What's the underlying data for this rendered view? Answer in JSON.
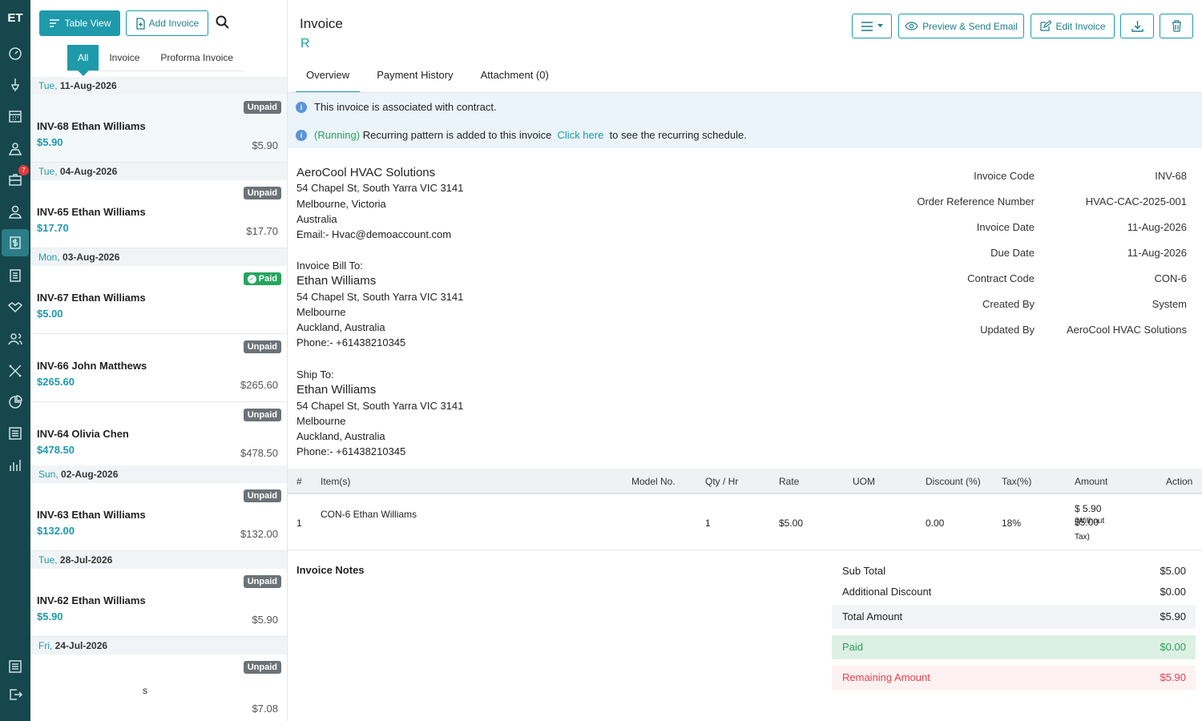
{
  "app": {
    "logo": "ET",
    "notification_count": "7"
  },
  "nav_icons": [
    "dashboard-icon",
    "pin-icon",
    "calendar-icon",
    "map-user-icon",
    "briefcase-icon",
    "user-icon",
    "invoice-dollar-icon",
    "list-icon",
    "handshake-icon",
    "users-icon",
    "tools-icon",
    "chart-pie-icon",
    "report-icon",
    "bar-chart-icon",
    "settings-icon",
    "logout-icon"
  ],
  "list": {
    "table_view_label": "Table View",
    "add_invoice_label": "Add Invoice",
    "filters": [
      "All",
      "Invoice",
      "Proforma Invoice"
    ],
    "groups": [
      {
        "weekday": "Tue,",
        "date": "11-Aug-2026",
        "items": [
          {
            "status": "Unpaid",
            "name": "INV-68 Ethan Williams",
            "amount": "$5.90",
            "amount_right": "$5.90"
          }
        ]
      },
      {
        "weekday": "Tue,",
        "date": "04-Aug-2026",
        "items": [
          {
            "status": "Unpaid",
            "name": "INV-65 Ethan Williams",
            "amount": "$17.70",
            "amount_right": "$17.70"
          }
        ]
      },
      {
        "weekday": "Mon,",
        "date": "03-Aug-2026",
        "items": [
          {
            "status": "Paid",
            "name": "INV-67 Ethan Williams",
            "amount": "$5.00",
            "amount_right": ""
          },
          {
            "status": "Unpaid",
            "name": "INV-66 John Matthews",
            "amount": "$265.60",
            "amount_right": "$265.60"
          },
          {
            "status": "Unpaid",
            "name": "INV-64 Olivia Chen",
            "amount": "$478.50",
            "amount_right": "$478.50"
          }
        ]
      },
      {
        "weekday": "Sun,",
        "date": "02-Aug-2026",
        "items": [
          {
            "status": "Unpaid",
            "name": "INV-63 Ethan Williams",
            "amount": "$132.00",
            "amount_right": "$132.00"
          }
        ]
      },
      {
        "weekday": "Tue,",
        "date": "28-Jul-2026",
        "items": [
          {
            "status": "Unpaid",
            "name": "INV-62 Ethan Williams",
            "amount": "$5.90",
            "amount_right": "$5.90"
          }
        ]
      },
      {
        "weekday": "Fri,",
        "date": "24-Jul-2026",
        "items": [
          {
            "status": "Unpaid",
            "name": "s",
            "amount": "",
            "amount_right": "$7.08"
          }
        ]
      }
    ]
  },
  "invoice": {
    "title": "Invoice",
    "subtitle": "R",
    "buttons": {
      "preview": "Preview & Send Email",
      "edit": "Edit Invoice"
    },
    "tabs": [
      "Overview",
      "Payment History",
      "Attachment (0)"
    ],
    "info1": "This invoice is associated with contract.",
    "info2_running": "(Running)",
    "info2_text": "Recurring pattern is added to this invoice",
    "info2_link": "Click here",
    "info2_tail": "to see the recurring schedule.",
    "company": {
      "name": "AeroCool HVAC Solutions",
      "line1": "54 Chapel St, South Yarra VIC 3141",
      "line2": "Melbourne, Victoria",
      "line3": "Australia",
      "email": "Email:- Hvac@demoaccount.com"
    },
    "bill_to": {
      "label": "Invoice Bill To:",
      "name": "Ethan Williams",
      "line1": "54 Chapel St, South Yarra VIC 3141",
      "line2": "Melbourne",
      "line3": "Auckland, Australia",
      "phone": "Phone:- +61438210345"
    },
    "ship_to": {
      "label": "Ship To:",
      "name": "Ethan Williams",
      "line1": "54 Chapel St, South Yarra VIC 3141",
      "line2": "Melbourne",
      "line3": "Auckland, Australia",
      "phone": "Phone:- +61438210345"
    },
    "details": [
      {
        "key": "Invoice Code",
        "value": "INV-68"
      },
      {
        "key": "Order Reference Number",
        "value": "HVAC-CAC-2025-001"
      },
      {
        "key": "Invoice Date",
        "value": "11-Aug-2026"
      },
      {
        "key": "Due Date",
        "value": "11-Aug-2026"
      },
      {
        "key": "Contract Code",
        "value": "CON-6"
      },
      {
        "key": "Created By",
        "value": "System"
      },
      {
        "key": "Updated By",
        "value": "AeroCool HVAC Solutions"
      }
    ],
    "table": {
      "headers": [
        "#",
        "Item(s)",
        "Model No.",
        "Qty / Hr",
        "Rate",
        "UOM",
        "Discount (%)",
        "Tax(%)",
        "Amount",
        "Action"
      ],
      "row": {
        "num": "1",
        "item": "CON-6 Ethan Williams",
        "model": "",
        "qty": "1",
        "rate": "$5.00",
        "uom": "",
        "discount": "0.00",
        "tax": "18%",
        "amount": "$ 5.90",
        "amount_wo": "$5.00",
        "amount_wo_note": "(Without",
        "amount_wo_note2": "Tax)"
      }
    },
    "notes_label": "Invoice Notes",
    "totals": {
      "sub_total_label": "Sub Total",
      "sub_total": "$5.00",
      "additional_discount_label": "Additional Discount",
      "additional_discount": "$0.00",
      "total_label": "Total Amount",
      "total": "$5.90",
      "paid_label": "Paid",
      "paid": "$0.00",
      "remaining_label": "Remaining Amount",
      "remaining": "$5.90"
    }
  }
}
